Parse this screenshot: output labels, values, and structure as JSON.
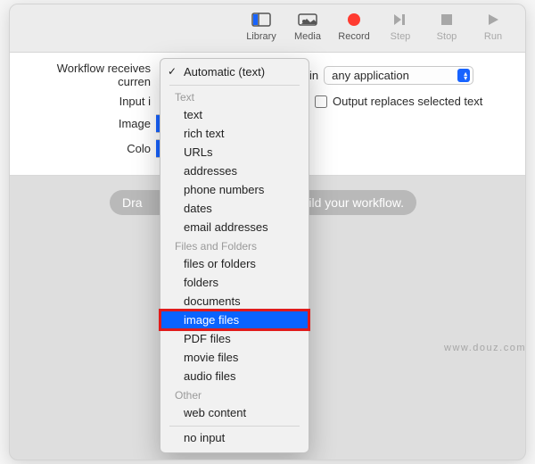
{
  "toolbar": {
    "library": "Library",
    "media": "Media",
    "record": "Record",
    "step": "Step",
    "stop": "Stop",
    "run": "Run"
  },
  "config": {
    "receives_label": "Workflow receives curren",
    "in_word": "in",
    "app_value": "any application",
    "input_label": "Input i",
    "image_label": "Image",
    "color_label": "Colo",
    "output_replaces": "Output replaces selected text"
  },
  "dropdown": {
    "current": "Automatic (text)",
    "heads": {
      "text": "Text",
      "files": "Files and Folders",
      "other": "Other"
    },
    "text_items": [
      "text",
      "rich text",
      "URLs",
      "addresses",
      "phone numbers",
      "dates",
      "email addresses"
    ],
    "files_items": [
      "files or folders",
      "folders",
      "documents",
      "image files",
      "PDF files",
      "movie files",
      "audio files"
    ],
    "other_items": [
      "web content"
    ],
    "no_input": "no input",
    "highlighted": "image files"
  },
  "canvas": {
    "drag_left": "Dra",
    "drag_right": "build your workflow."
  },
  "watermark": "www.douz.com"
}
